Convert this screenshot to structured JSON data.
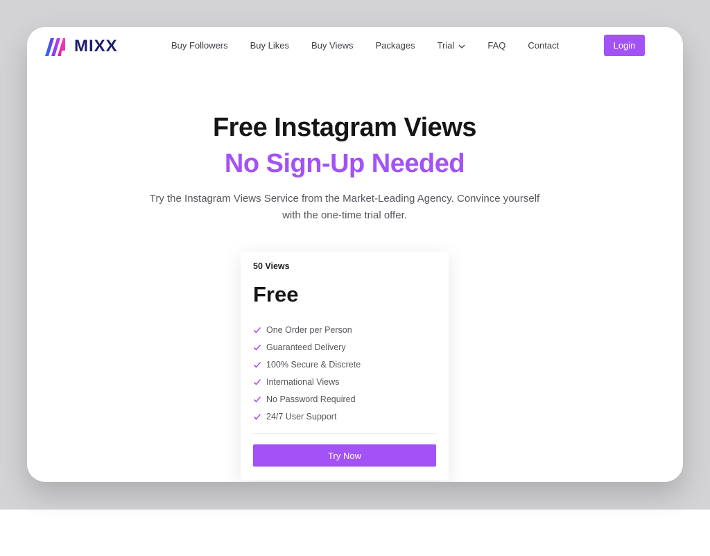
{
  "brand": {
    "name": "MIXX"
  },
  "nav": {
    "items": [
      "Buy Followers",
      "Buy Likes",
      "Buy Views",
      "Packages",
      "Trial",
      "FAQ",
      "Contact"
    ],
    "login_label": "Login"
  },
  "hero": {
    "title": "Free Instagram Views",
    "subtitle": "No Sign-Up Needed",
    "description": "Try the Instagram Views Service from the Market-Leading Agency. Convince yourself with the one-time trial offer."
  },
  "card": {
    "quantity": "50 Views",
    "price": "Free",
    "features": [
      "One Order per Person",
      "Guaranteed Delivery",
      "100% Secure & Discrete",
      "International Views",
      "No Password Required",
      "24/7 User Support"
    ],
    "cta_label": "Try Now"
  },
  "colors": {
    "accent": "#a352f7",
    "brand_dark": "#1d1d6b",
    "backdrop": "#d3d3d5"
  },
  "icons": {
    "logo": "mixx-logo-icon",
    "dropdown": "chevron-down-icon",
    "feature": "check-icon"
  }
}
